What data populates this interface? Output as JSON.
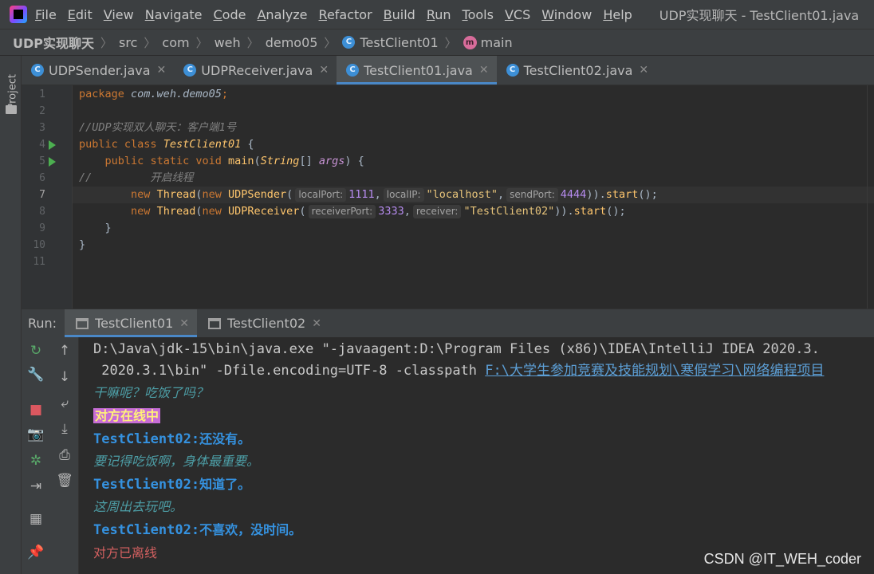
{
  "menu": {
    "items": [
      "File",
      "Edit",
      "View",
      "Navigate",
      "Code",
      "Analyze",
      "Refactor",
      "Build",
      "Run",
      "Tools",
      "VCS",
      "Window",
      "Help"
    ],
    "window_title": "UDP实现聊天 - TestClient01.java"
  },
  "breadcrumb": {
    "project": "UDP实现聊天",
    "parts": [
      "src",
      "com",
      "weh",
      "demo05"
    ],
    "class_name": "TestClient01",
    "method": "main"
  },
  "side_panel": {
    "project_label": "Project"
  },
  "editor_tabs": [
    {
      "label": "UDPSender.java",
      "active": false
    },
    {
      "label": "UDPReceiver.java",
      "active": false
    },
    {
      "label": "TestClient01.java",
      "active": true
    },
    {
      "label": "TestClient02.java",
      "active": false
    }
  ],
  "code": {
    "line_numbers": [
      "1",
      "2",
      "3",
      "4",
      "5",
      "6",
      "7",
      "8",
      "9",
      "10",
      "11"
    ],
    "current_line": 7,
    "run_markers": [
      4,
      5
    ],
    "line1": {
      "kw": "package",
      "name": "com.weh.demo05",
      "end": ";"
    },
    "line3": "//UDP实现双人聊天：客户端1号",
    "line4": {
      "kw1": "public",
      "kw2": "class",
      "name": "TestClient01",
      "end": " {"
    },
    "line5": {
      "kw1": "public",
      "kw2": "static",
      "kw3": "void",
      "name": "main",
      "open": "(",
      "type": "String",
      "arr": "[] ",
      "param": "args",
      "end": ") {"
    },
    "line6": {
      "slashes": "//",
      "comment": "开启线程"
    },
    "line7": {
      "kw_new1": "new",
      "thread": "Thread",
      "open1": "(",
      "kw_new2": "new",
      "cls": "UDPSender",
      "open2": "(",
      "h1": "localPort:",
      "v1": "1111",
      "c1": ",",
      "h2": "localIP:",
      "v2": "\"localhost\"",
      "c2": ",",
      "h3": "sendPort:",
      "v3": "4444",
      "close": ")).",
      "start": "start",
      "end": "();"
    },
    "line8": {
      "kw_new1": "new",
      "thread": "Thread",
      "open1": "(",
      "kw_new2": "new",
      "cls": "UDPReceiver",
      "open2": "(",
      "h1": "receiverPort:",
      "v1": "3333",
      "c1": ",",
      "h2": "receiver:",
      "v2": "\"TestClient02\"",
      "close": ")).",
      "start": "start",
      "end": "();"
    },
    "line9": "}",
    "line10": "}"
  },
  "run_panel": {
    "label": "Run:",
    "tabs": [
      {
        "label": "TestClient01",
        "active": true
      },
      {
        "label": "TestClient02",
        "active": false
      }
    ]
  },
  "console": {
    "cmd_line1": "D:\\Java\\jdk-15\\bin\\java.exe \"-javaagent:D:\\Program Files (x86)\\IDEA\\IntelliJ IDEA 2020.3.",
    "cmd_line2_text": " 2020.3.1\\bin\" -Dfile.encoding=UTF-8 -classpath ",
    "cmd_line2_link": "F:\\大学生参加竞赛及技能规划\\寒假学习\\网络编程项目",
    "msg1": "干嘛呢？吃饭了吗？",
    "online": "对方在线中",
    "reply1_sender": "TestClient02:",
    "reply1_text": "还没有。",
    "msg2": "要记得吃饭啊，身体最重要。",
    "reply2_sender": "TestClient02:",
    "reply2_text": "知道了。",
    "msg3": "这周出去玩吧。",
    "reply3_sender": "TestClient02:",
    "reply3_text": "不喜欢，没时间。",
    "offline": "对方已离线"
  },
  "watermark": "CSDN @IT_WEH_coder"
}
